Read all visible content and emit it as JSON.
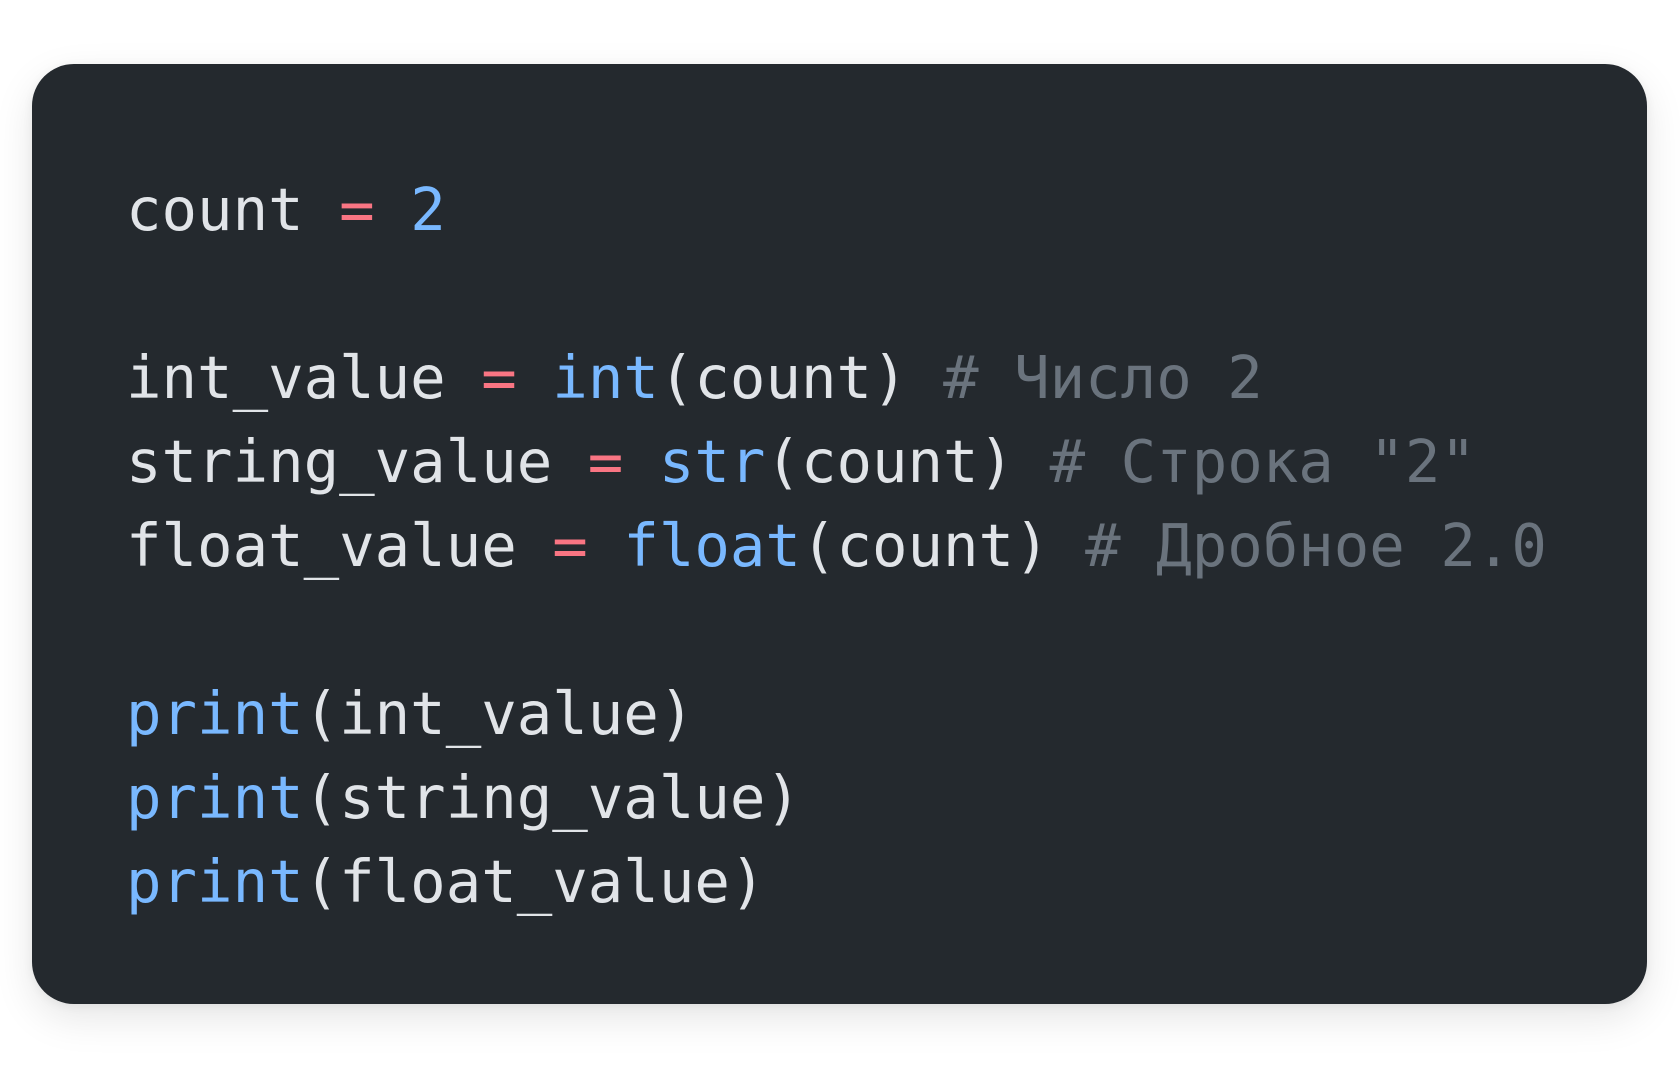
{
  "colors": {
    "page_background": "#ffffff",
    "card_background": "#24292e",
    "identifier": "#e1e4e8",
    "operator": "#f97583",
    "number_and_builtin": "#79b8ff",
    "comment": "#6a737d"
  },
  "code": {
    "language": "python",
    "lines": [
      {
        "id": "line-1",
        "tokens": [
          {
            "type": "ident",
            "text": "count"
          },
          {
            "type": "space",
            "text": " "
          },
          {
            "type": "op",
            "text": "="
          },
          {
            "type": "space",
            "text": " "
          },
          {
            "type": "num",
            "text": "2"
          }
        ]
      },
      {
        "id": "line-2",
        "tokens": []
      },
      {
        "id": "line-3",
        "tokens": [
          {
            "type": "ident",
            "text": "int_value"
          },
          {
            "type": "space",
            "text": " "
          },
          {
            "type": "op",
            "text": "="
          },
          {
            "type": "space",
            "text": " "
          },
          {
            "type": "builtin",
            "text": "int"
          },
          {
            "type": "punc",
            "text": "(count)"
          },
          {
            "type": "space",
            "text": " "
          },
          {
            "type": "comment",
            "text": "# Число 2"
          }
        ]
      },
      {
        "id": "line-4",
        "tokens": [
          {
            "type": "ident",
            "text": "string_value"
          },
          {
            "type": "space",
            "text": " "
          },
          {
            "type": "op",
            "text": "="
          },
          {
            "type": "space",
            "text": " "
          },
          {
            "type": "builtin",
            "text": "str"
          },
          {
            "type": "punc",
            "text": "(count)"
          },
          {
            "type": "space",
            "text": " "
          },
          {
            "type": "comment",
            "text": "# Строка \"2\""
          }
        ]
      },
      {
        "id": "line-5",
        "tokens": [
          {
            "type": "ident",
            "text": "float_value"
          },
          {
            "type": "space",
            "text": " "
          },
          {
            "type": "op",
            "text": "="
          },
          {
            "type": "space",
            "text": " "
          },
          {
            "type": "builtin",
            "text": "float"
          },
          {
            "type": "punc",
            "text": "(count)"
          },
          {
            "type": "space",
            "text": " "
          },
          {
            "type": "comment",
            "text": "# Дробное 2.0"
          }
        ]
      },
      {
        "id": "line-6",
        "tokens": []
      },
      {
        "id": "line-7",
        "tokens": [
          {
            "type": "builtin",
            "text": "print"
          },
          {
            "type": "punc",
            "text": "(int_value)"
          }
        ]
      },
      {
        "id": "line-8",
        "tokens": [
          {
            "type": "builtin",
            "text": "print"
          },
          {
            "type": "punc",
            "text": "(string_value)"
          }
        ]
      },
      {
        "id": "line-9",
        "tokens": [
          {
            "type": "builtin",
            "text": "print"
          },
          {
            "type": "punc",
            "text": "(float_value)"
          }
        ]
      }
    ]
  }
}
